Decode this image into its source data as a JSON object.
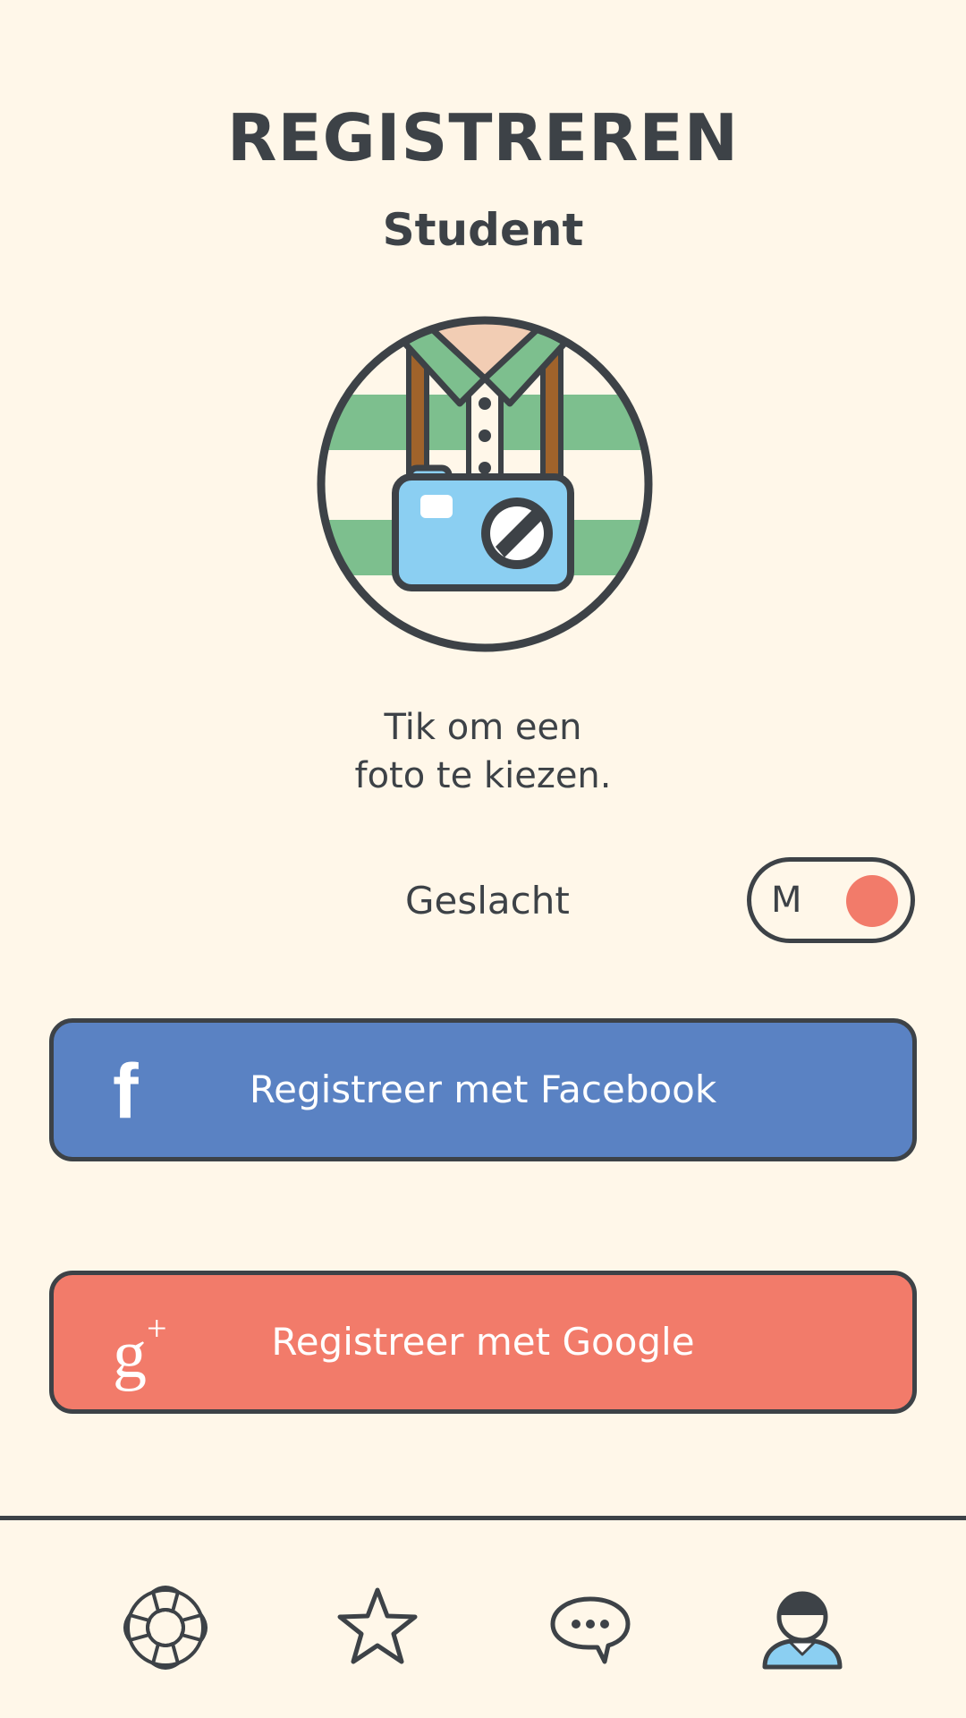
{
  "header": {
    "title": "REGISTREREN",
    "subtitle": "Student"
  },
  "avatar": {
    "hint_line1": "Tik om een",
    "hint_line2": "foto te kiezen."
  },
  "gender": {
    "label": "Geslacht",
    "value": "M"
  },
  "buttons": {
    "facebook_label": "Registreer met Facebook",
    "facebook_icon_glyph": "f",
    "google_label": "Registreer met Google",
    "google_icon_glyph": "g"
  },
  "nav": {
    "items": [
      {
        "icon": "lifebuoy-icon"
      },
      {
        "icon": "star-icon"
      },
      {
        "icon": "chat-bubble-icon"
      },
      {
        "icon": "user-profile-icon",
        "active": true
      }
    ]
  },
  "colors": {
    "background": "#FFF7E9",
    "ink": "#3D4247",
    "facebook": "#5A82C3",
    "google": "#F27B6A",
    "toggle_knob": "#F27B6A",
    "stripe_green": "#7DBF8E",
    "camera_blue": "#8BCFF2"
  }
}
